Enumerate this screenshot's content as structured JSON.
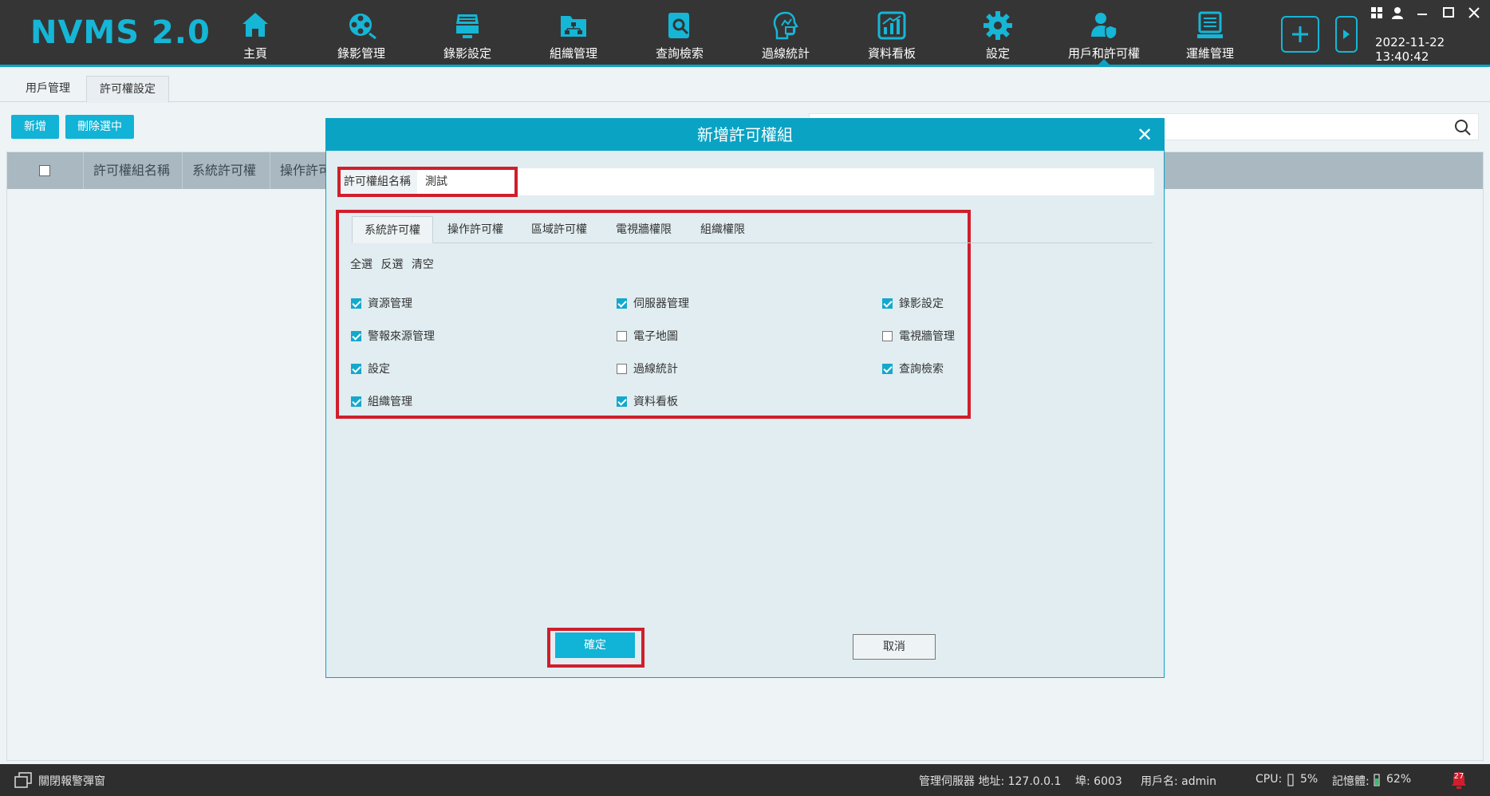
{
  "app": {
    "title": "NVMS 2.0",
    "datetime": "2022-11-22 13:40:42"
  },
  "nav": [
    {
      "label": "主頁",
      "icon": "home-icon"
    },
    {
      "label": "錄影管理",
      "icon": "film-reel-icon"
    },
    {
      "label": "錄影設定",
      "icon": "recorder-icon"
    },
    {
      "label": "組織管理",
      "icon": "org-folder-icon"
    },
    {
      "label": "查詢檢索",
      "icon": "search-doc-icon"
    },
    {
      "label": "過線統計",
      "icon": "head-stats-icon"
    },
    {
      "label": "資料看板",
      "icon": "chart-board-icon"
    },
    {
      "label": "設定",
      "icon": "gear-icon"
    },
    {
      "label": "用戶和許可權",
      "icon": "user-shield-icon"
    },
    {
      "label": "運維管理",
      "icon": "monitor-icon"
    }
  ],
  "subtabs": [
    "用戶管理",
    "許可權設定"
  ],
  "toolbar": {
    "add": "新增",
    "delete_selected": "刪除選中"
  },
  "table": {
    "headers": [
      "許可權組名稱",
      "系統許可權",
      "操作許可權"
    ]
  },
  "modal": {
    "title": "新增許可權組",
    "name_label": "許可權組名稱",
    "name_value": "測試",
    "tabs": [
      "系統許可權",
      "操作許可權",
      "區域許可權",
      "電視牆權限",
      "組織權限"
    ],
    "links": [
      "全選",
      "反選",
      "清空"
    ],
    "permissions": [
      {
        "label": "資源管理",
        "checked": true
      },
      {
        "label": "伺服器管理",
        "checked": true
      },
      {
        "label": "錄影設定",
        "checked": true
      },
      {
        "label": "警報來源管理",
        "checked": true
      },
      {
        "label": "電子地圖",
        "checked": false
      },
      {
        "label": "電視牆管理",
        "checked": false
      },
      {
        "label": "設定",
        "checked": true
      },
      {
        "label": "過線統計",
        "checked": false
      },
      {
        "label": "查詢檢索",
        "checked": true
      },
      {
        "label": "組織管理",
        "checked": true
      },
      {
        "label": "資料看板",
        "checked": true
      }
    ],
    "ok": "確定",
    "cancel": "取消"
  },
  "status": {
    "close_alarm": "關閉報警彈窗",
    "server": "管理伺服器 地址: 127.0.0.1",
    "port": "埠: 6003",
    "user": "用戶名: admin",
    "cpu_label": "CPU:",
    "cpu_value": "5%",
    "mem_label": "記憶體:",
    "mem_value": "62%",
    "alarm_count": "27"
  },
  "colors": {
    "accent": "#0aa3c4",
    "highlight": "#d01e2c",
    "topbar": "#353535"
  }
}
